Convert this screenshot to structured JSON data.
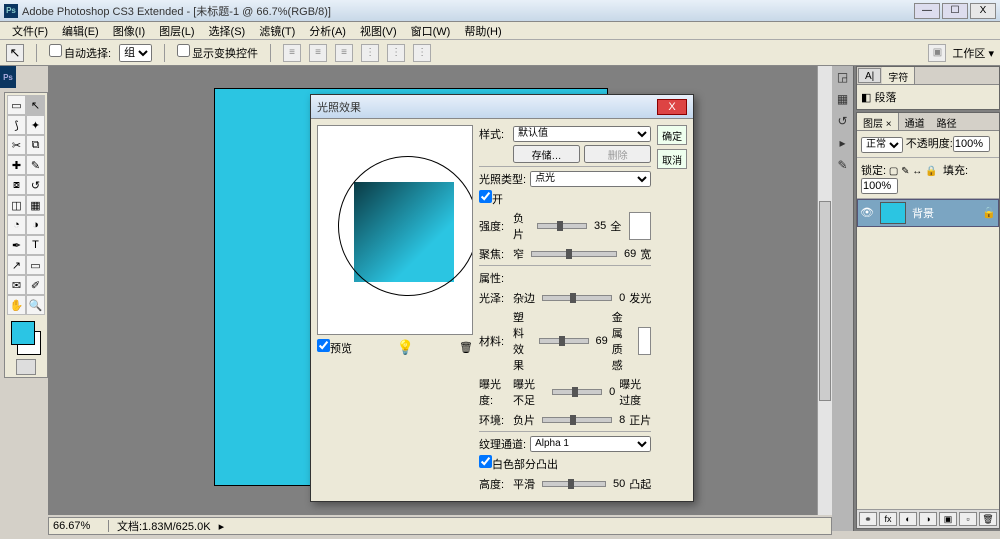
{
  "app": {
    "title": "Adobe Photoshop CS3 Extended - [未标题-1 @ 66.7%(RGB/8)]",
    "icon": "Ps"
  },
  "win": {
    "min": "—",
    "max": "☐",
    "close": "X"
  },
  "menu": [
    "文件(F)",
    "编辑(E)",
    "图像(I)",
    "图层(L)",
    "选择(S)",
    "滤镜(T)",
    "分析(A)",
    "视图(V)",
    "窗口(W)",
    "帮助(H)"
  ],
  "optbar": {
    "auto_select_label": "自动选择:",
    "group": "组",
    "show_transform": "显示变换控件",
    "workspace": "工作区 ▾"
  },
  "status": {
    "zoom": "66.67%",
    "doc": "文档:1.83M/625.0K"
  },
  "char_panel": {
    "tab1": "字符",
    "para": "段落"
  },
  "layers": {
    "tabs": [
      "图层 ×",
      "通道",
      "路径"
    ],
    "blend": "正常",
    "opacity_label": "不透明度:",
    "opacity": "100%",
    "lock": "锁定:",
    "fill_label": "填充:",
    "fill": "100%",
    "bg_layer": "背景"
  },
  "dialog": {
    "title": "光照效果",
    "ok": "确定",
    "cancel": "取消",
    "style_label": "样式:",
    "style": "默认值",
    "save": "存储…",
    "delete": "删除",
    "light_type_label": "光照类型:",
    "light_type": "点光",
    "on": "开",
    "intensity": "强度:",
    "i_left": "负片",
    "i_val": "35",
    "i_right": "全",
    "focus": "聚焦:",
    "f_left": "窄",
    "f_val": "69",
    "f_right": "宽",
    "props": "属性:",
    "gloss": "光泽:",
    "g_left": "杂边",
    "g_val": "0",
    "g_right": "发光",
    "material": "材料:",
    "m_left": "塑料效果",
    "m_val": "69",
    "m_right": "金属质感",
    "exposure": "曝光度:",
    "e_left": "曝光不足",
    "e_val": "0",
    "e_right": "曝光过度",
    "ambience": "环境:",
    "a_left": "负片",
    "a_val": "8",
    "a_right": "正片",
    "tex_label": "纹理通道:",
    "tex": "Alpha 1",
    "white_high": "白色部分凸出",
    "height": "高度:",
    "h_left": "平滑",
    "h_val": "50",
    "h_right": "凸起",
    "preview": "预览"
  }
}
